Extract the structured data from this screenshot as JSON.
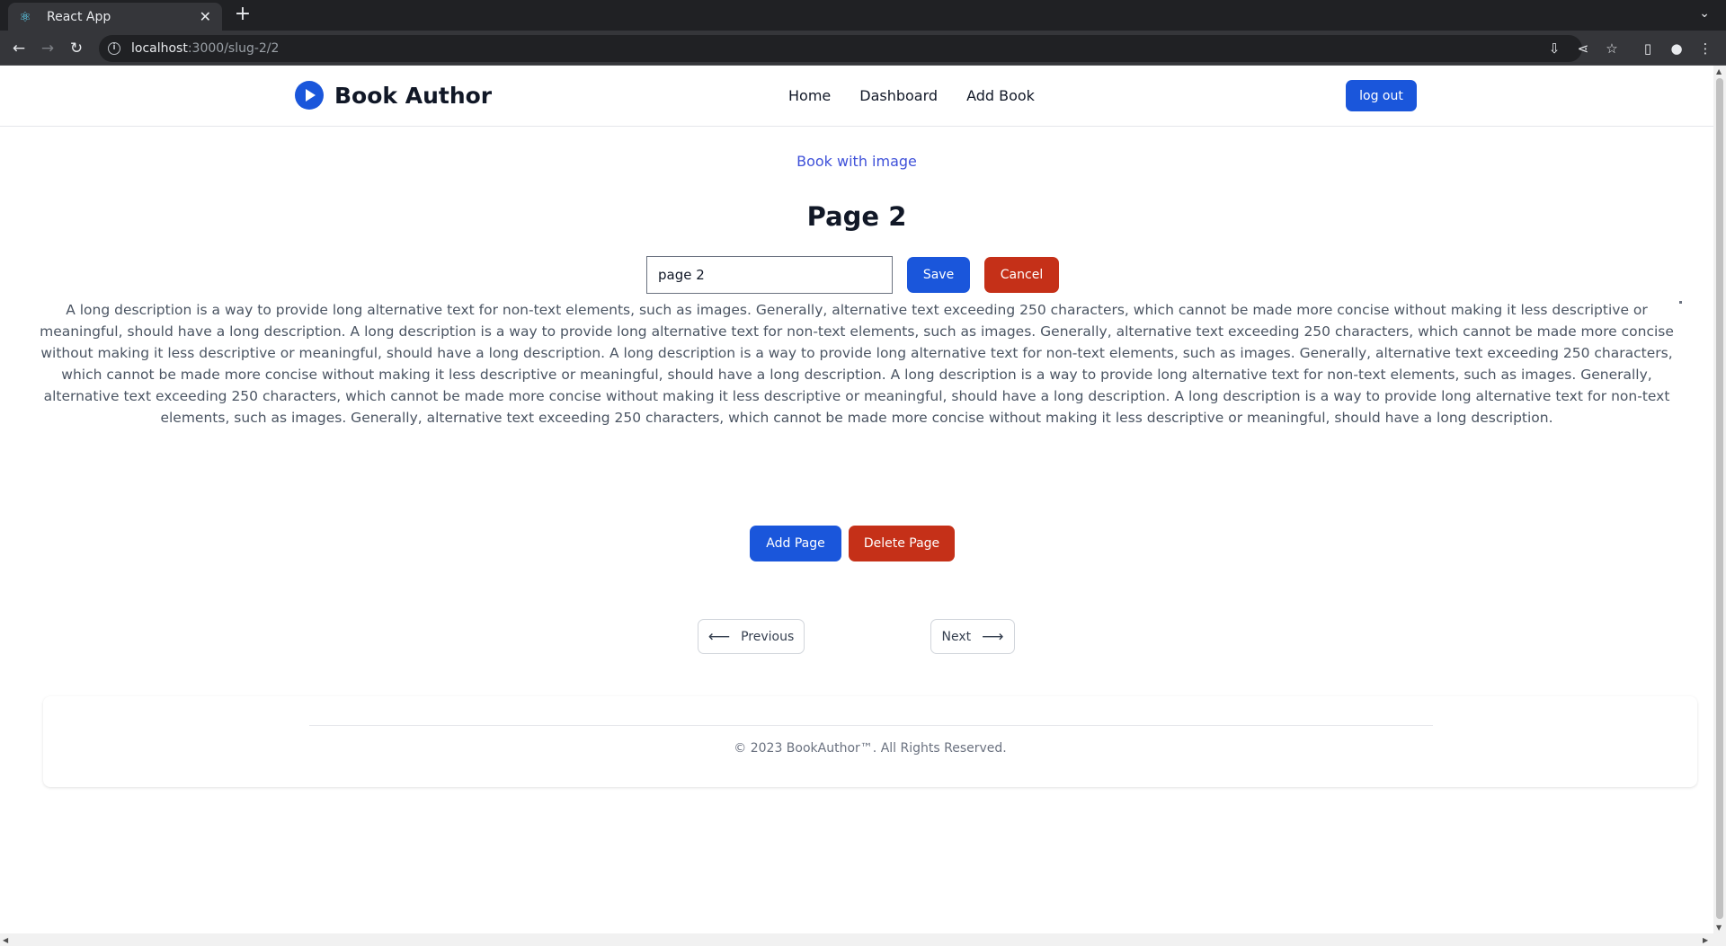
{
  "browser": {
    "tab_title": "React App",
    "tab_icon": "react-icon",
    "new_tab_label": "+",
    "url_host": "localhost",
    "url_path": ":3000/slug-2/2"
  },
  "header": {
    "brand": "Book Author",
    "nav": [
      "Home",
      "Dashboard",
      "Add Book"
    ],
    "logout_label": "log out",
    "accent_color": "#1a56db"
  },
  "main": {
    "book_link": "Book with image",
    "page_title": "Page 2",
    "page_input_value": "page 2",
    "save_label": "Save",
    "cancel_label": "Cancel",
    "description": "A long description is a way to provide long alternative text for non-text elements, such as images. Generally, alternative text exceeding 250 characters, which cannot be made more concise without making it less descriptive or meaningful, should have a long description. A long description is a way to provide long alternative text for non-text elements, such as images. Generally, alternative text exceeding 250 characters, which cannot be made more concise without making it less descriptive or meaningful, should have a long description. A long description is a way to provide long alternative text for non-text elements, such as images. Generally, alternative text exceeding 250 characters, which cannot be made more concise without making it less descriptive or meaningful, should have a long description. A long description is a way to provide long alternative text for non-text elements, such as images. Generally, alternative text exceeding 250 characters, which cannot be made more concise without making it less descriptive or meaningful, should have a long description. A long description is a way to provide long alternative text for non-text elements, such as images. Generally, alternative text exceeding 250 characters, which cannot be made more concise without making it less descriptive or meaningful, should have a long description.",
    "add_page_label": "Add Page",
    "delete_page_label": "Delete Page",
    "prev_label": "Previous",
    "next_label": "Next",
    "danger_color": "#c53018"
  },
  "footer": {
    "copyright": "© 2023 BookAuthor™. All Rights Reserved."
  }
}
